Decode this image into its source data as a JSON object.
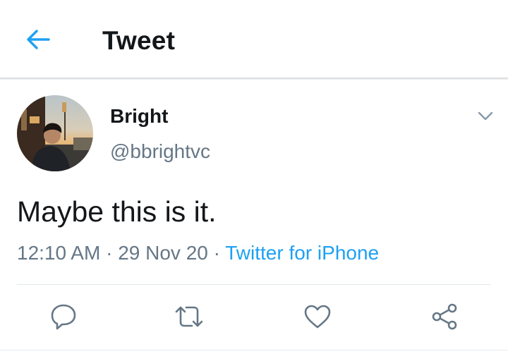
{
  "header": {
    "title": "Tweet",
    "back_icon": "arrow-left-icon",
    "accent_color": "#1da1f2"
  },
  "tweet": {
    "author_name": "Bright",
    "author_handle": "@bbrightvc",
    "text": "Maybe this is it.",
    "time": "12:10 AM",
    "date": "29 Nov 20",
    "separator": "·",
    "source": "Twitter for iPhone",
    "menu_icon": "chevron-down-icon"
  },
  "actions": [
    {
      "name": "reply",
      "icon": "speech-bubble-icon"
    },
    {
      "name": "retweet",
      "icon": "retweet-arrows-icon"
    },
    {
      "name": "like",
      "icon": "heart-outline-icon"
    },
    {
      "name": "share",
      "icon": "share-nodes-icon"
    }
  ],
  "colors": {
    "text_primary": "#14171a",
    "text_secondary": "#657786",
    "link": "#1da1f2",
    "divider": "#e1e8ed"
  }
}
